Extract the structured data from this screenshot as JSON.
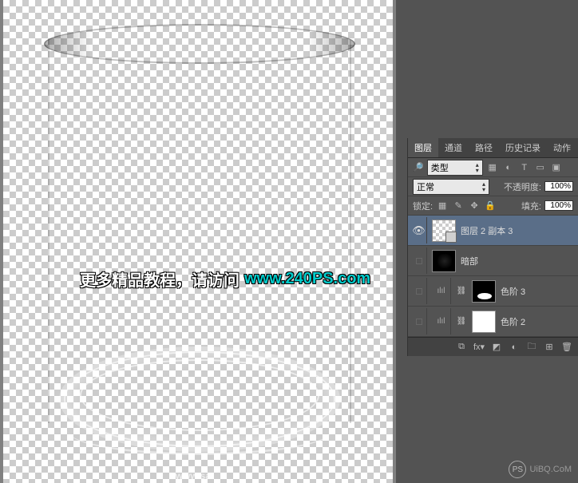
{
  "overlay": {
    "cn_text": "更多精品教程，请访问",
    "url_text": "www.240PS.com"
  },
  "watermark": {
    "bottom_right": "www.sa",
    "logo_text": "UiBQ.CoM",
    "logo_badge": "PS"
  },
  "panel": {
    "tabs": {
      "layers": "图层",
      "channels": "通道",
      "paths": "路径",
      "history": "历史记录",
      "actions": "动作"
    },
    "type_dropdown": "类型",
    "type_icons": {
      "img": "▦",
      "adj": "◐",
      "text": "T",
      "shape": "▭",
      "smart": "▣"
    },
    "blend_mode": "正常",
    "opacity_label": "不透明度:",
    "opacity_value": "100%",
    "lock_label": "锁定:",
    "fill_label": "填充:",
    "fill_value": "100%",
    "layers": [
      {
        "name": "图层 2 副本 3",
        "visible": true,
        "selected": true,
        "thumb": "checker",
        "adjust": false
      },
      {
        "name": "暗部",
        "visible": false,
        "selected": false,
        "thumb": "dark",
        "adjust": false
      },
      {
        "name": "色阶 3",
        "visible": false,
        "selected": false,
        "thumb": "mask-black",
        "adjust": true
      },
      {
        "name": "色阶 2",
        "visible": false,
        "selected": false,
        "thumb": "white",
        "adjust": true
      }
    ],
    "footer": {
      "link": "⧉",
      "fx": "fx▾",
      "mask": "◩",
      "adj": "◐",
      "group": "🗀",
      "new": "⊞",
      "trash": "🗑"
    }
  },
  "lock_icons": {
    "trans": "▦",
    "brush": "✎",
    "move": "✥",
    "lock": "🔒"
  },
  "search_icon": "🔎",
  "levels_icon": "ılıl"
}
